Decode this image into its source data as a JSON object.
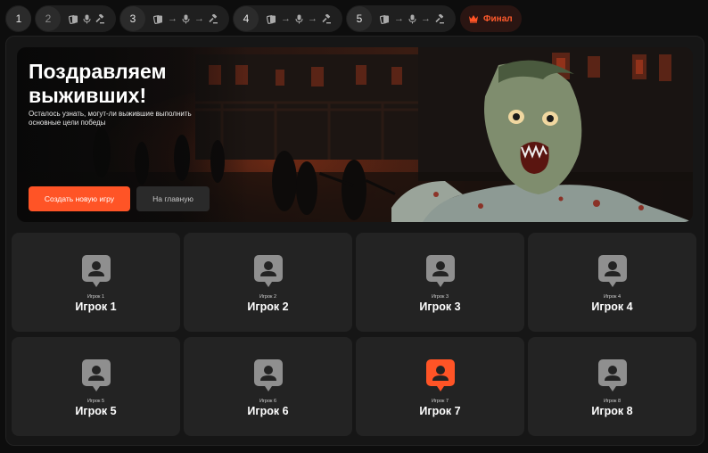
{
  "rounds": [
    {
      "number": "1",
      "active": true
    },
    {
      "number": "2",
      "active": false
    },
    {
      "number": "3",
      "active": true
    },
    {
      "number": "4",
      "active": true
    },
    {
      "number": "5",
      "active": true
    }
  ],
  "round_step_icons": [
    "cards-icon",
    "microphone-icon",
    "gavel-icon"
  ],
  "final_label": "Финал",
  "hero": {
    "title": "Поздравляем выживших!",
    "subtitle": "Осталось узнать, могут-ли выжившие выполнить основные цели победы",
    "primary_button": "Создать новую игру",
    "secondary_button": "На главную"
  },
  "players": [
    {
      "small": "Игрок 1",
      "name": "Игрок 1",
      "highlight": false
    },
    {
      "small": "Игрок 2",
      "name": "Игрок 2",
      "highlight": false
    },
    {
      "small": "Игрок 3",
      "name": "Игрок 3",
      "highlight": false
    },
    {
      "small": "Игрок 4",
      "name": "Игрок 4",
      "highlight": false
    },
    {
      "small": "Игрок 5",
      "name": "Игрок 5",
      "highlight": false
    },
    {
      "small": "Игрок 6",
      "name": "Игрок 6",
      "highlight": false
    },
    {
      "small": "Игрок 7",
      "name": "Игрок 7",
      "highlight": true
    },
    {
      "small": "Игрок 8",
      "name": "Игрок 8",
      "highlight": false
    }
  ],
  "colors": {
    "accent": "#ff5426",
    "pin_default": "#8f8f8f",
    "pin_highlight": "#ff5426",
    "final_bg": "#2a1512"
  }
}
